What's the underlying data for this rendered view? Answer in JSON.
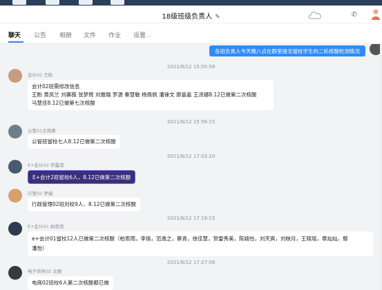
{
  "window": {
    "title": "18级班级负责人",
    "edit_icon": "pencil-icon",
    "right_icons": [
      "cloud-icon",
      "phone-icon",
      "person-icon"
    ]
  },
  "tabs": [
    {
      "label": "聊天",
      "active": true
    },
    {
      "label": "公告",
      "active": false
    },
    {
      "label": "相册",
      "active": false
    },
    {
      "label": "文件",
      "active": false
    },
    {
      "label": "作业",
      "active": false,
      "badge": true
    },
    {
      "label": "设置",
      "active": false,
      "dropdown": true
    }
  ],
  "colors": {
    "accent": "#2f7cf6",
    "my_bubble": "#2f8bf5",
    "highlight_bubble": "#3b2f7a",
    "badge": "#f04134"
  },
  "messages": {
    "my_message": "各班负责人今天晚八点在群里接龙留校学生的二轮核酸检测情况",
    "m1": {
      "timestamp": "2021/8/12 15:50:58",
      "name": "会计02 王盼",
      "line1": "会计02班需修改信息",
      "line2": "王盼 黄凤兰 刘赛薇 张梦辉 刘雅璐 罗源 秦慧敏 杨佩佩 潘锋文 廖嘉嘉 王泽娜8.12已做第二次核酸",
      "line3": "马慧佳8.12已做第七次核酸"
    },
    "m2": {
      "timestamp": "2021/8/12 15:56:15",
      "name": "公管01王雨寒",
      "text": "公管班留校七人8.12已做第二次核酸"
    },
    "m3": {
      "timestamp": "2021/8/12 17:03:20",
      "name": "E+会计02 常露淇",
      "text": "E+会计2班留校6人，8.12已做第二次核酸"
    },
    "m4": {
      "name": "行管02 罗缦",
      "text": "行政管理02班刘校9人、8.12已做第二次核酸"
    },
    "m5": {
      "timestamp": "2021/8/12 17:19:15",
      "name": "E+会计01 柏思雨",
      "line1": "e+会计01留校12人已做第二次核酸（柏思雨，李倩，范逸之，蔡青，徐佳慧，贺雷秀美，陈婧怡，刘天爽，刘映月，王晓瑶，章灿灿，鄢",
      "line2": "潘怡）"
    },
    "m6": {
      "timestamp": "2021/8/12 17:27:08",
      "name": "电子商务02 文静",
      "text": "电商02班校6人第二次核酸都已做"
    }
  }
}
